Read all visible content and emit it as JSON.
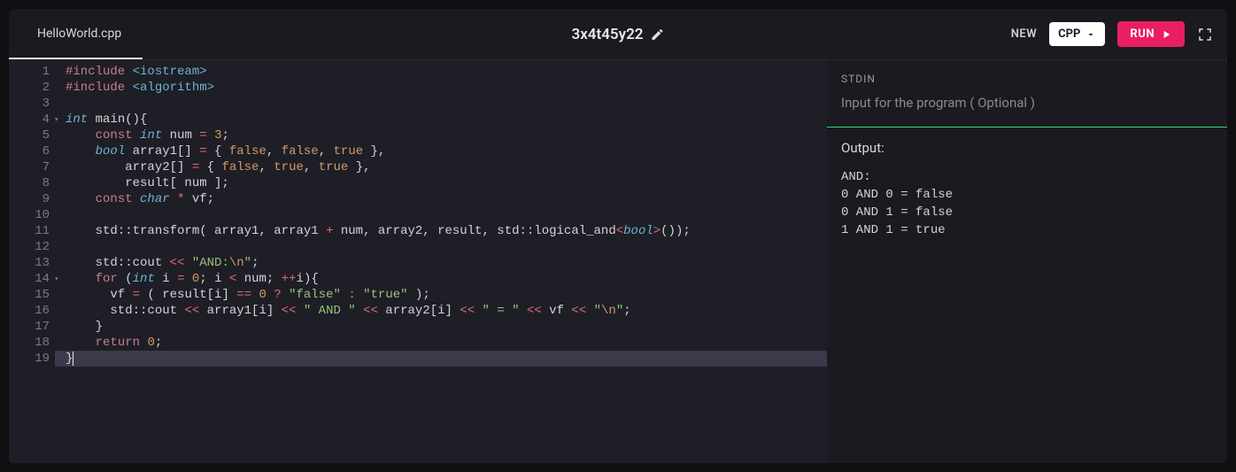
{
  "header": {
    "tab_filename": "HelloWorld.cpp",
    "title": "3x4t45y22",
    "new_label": "NEW",
    "lang_label": "CPP",
    "run_label": "RUN"
  },
  "code": {
    "lines": [
      {
        "n": 1,
        "html": "<span class='kw-inc'>#include</span> <span class='kw-lib'>&lt;iostream&gt;</span>"
      },
      {
        "n": 2,
        "html": "<span class='kw-inc'>#include</span> <span class='kw-lib'>&lt;algorithm&gt;</span>"
      },
      {
        "n": 3,
        "html": ""
      },
      {
        "n": 4,
        "html": "<span class='kw-type'>int</span> main(){",
        "fold": true
      },
      {
        "n": 5,
        "html": "    <span class='kw-const'>const</span> <span class='kw-type'>int</span> num <span class='kw-op'>=</span> <span class='kw-num'>3</span>;"
      },
      {
        "n": 6,
        "html": "    <span class='kw-type'>bool</span> array1[] <span class='kw-op'>=</span> { <span class='kw-bool'>false</span>, <span class='kw-bool'>false</span>, <span class='kw-bool'>true</span> },"
      },
      {
        "n": 7,
        "html": "        array2[] <span class='kw-op'>=</span> { <span class='kw-bool'>false</span>, <span class='kw-bool'>true</span>, <span class='kw-bool'>true</span> },"
      },
      {
        "n": 8,
        "html": "        result[ num ];"
      },
      {
        "n": 9,
        "html": "    <span class='kw-const'>const</span> <span class='kw-type'>char</span> <span class='kw-op'>*</span> vf;"
      },
      {
        "n": 10,
        "html": ""
      },
      {
        "n": 11,
        "html": "    std::transform( array1, array1 <span class='kw-op'>+</span> num, array2, result, std::logical_and<span class='kw-op'>&lt;</span><span class='kw-type'>bool</span><span class='kw-op'>&gt;</span>());"
      },
      {
        "n": 12,
        "html": ""
      },
      {
        "n": 13,
        "html": "    std::cout <span class='kw-op'>&lt;&lt;</span> <span class='kw-str'>\"AND:</span><span class='kw-esc'>\\n</span><span class='kw-str'>\"</span>;"
      },
      {
        "n": 14,
        "html": "    <span class='kw-ctrl'>for</span> (<span class='kw-type'>int</span> i <span class='kw-op'>=</span> <span class='kw-num'>0</span>; i <span class='kw-op'>&lt;</span> num; <span class='kw-op'>++</span>i){",
        "fold": true
      },
      {
        "n": 15,
        "html": "      vf <span class='kw-op'>=</span> ( result[i] <span class='kw-op'>==</span> <span class='kw-num'>0</span> <span class='kw-op'>?</span> <span class='kw-str'>\"false\"</span> <span class='kw-op'>:</span> <span class='kw-str'>\"true\"</span> );"
      },
      {
        "n": 16,
        "html": "      std::cout <span class='kw-op'>&lt;&lt;</span> array1[i] <span class='kw-op'>&lt;&lt;</span> <span class='kw-str'>\" AND \"</span> <span class='kw-op'>&lt;&lt;</span> array2[i] <span class='kw-op'>&lt;&lt;</span> <span class='kw-str'>\" = \"</span> <span class='kw-op'>&lt;&lt;</span> vf <span class='kw-op'>&lt;&lt;</span> <span class='kw-str'>\"</span><span class='kw-esc'>\\n</span><span class='kw-str'>\"</span>;"
      },
      {
        "n": 17,
        "html": "    }"
      },
      {
        "n": 18,
        "html": "    <span class='kw-ctrl'>return</span> <span class='kw-num'>0</span>;"
      },
      {
        "n": 19,
        "html": "}<span class='cursor'></span>",
        "active": true
      }
    ]
  },
  "stdin": {
    "label": "STDIN",
    "placeholder": "Input for the program ( Optional )"
  },
  "output": {
    "label": "Output:",
    "text": "AND:\n0 AND 0 = false\n0 AND 1 = false\n1 AND 1 = true"
  }
}
